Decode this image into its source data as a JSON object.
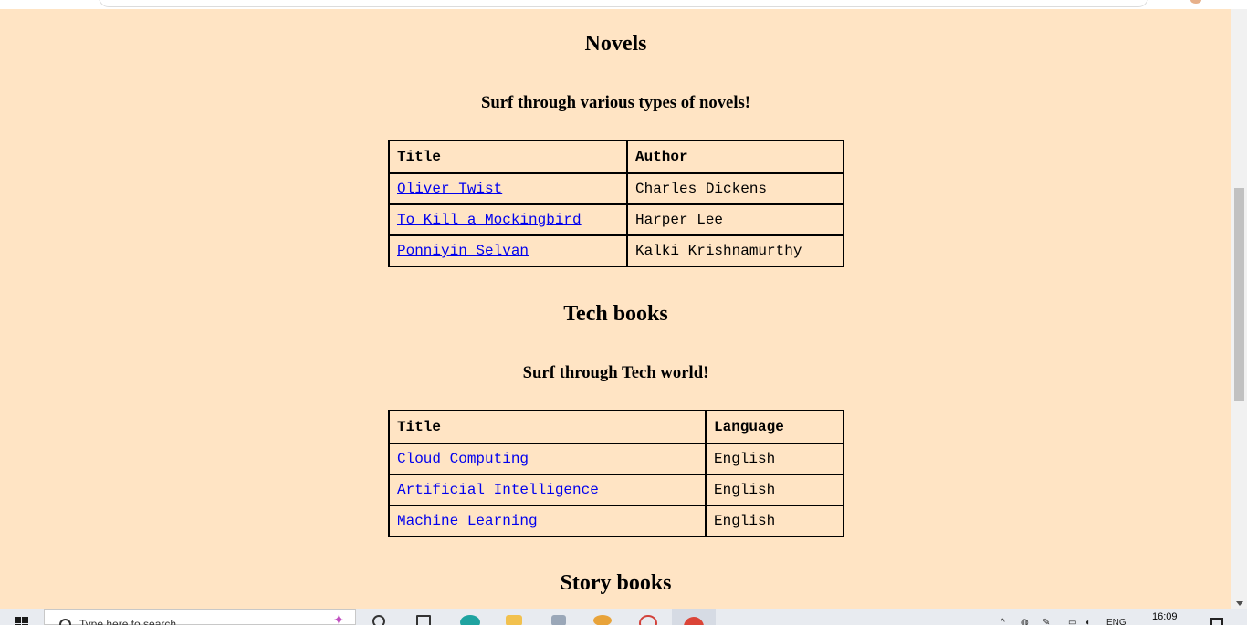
{
  "sections": [
    {
      "title": "Novels",
      "subtitle": "Surf through various types of novels!",
      "columns": [
        "Title",
        "Author"
      ],
      "rows": [
        {
          "title": "Oliver Twist",
          "value": "Charles Dickens"
        },
        {
          "title": "To Kill a Mockingbird",
          "value": "Harper Lee"
        },
        {
          "title": "Ponniyin Selvan",
          "value": "Kalki Krishnamurthy"
        }
      ]
    },
    {
      "title": "Tech books",
      "subtitle": "Surf through Tech world!",
      "columns": [
        "Title",
        "Language"
      ],
      "rows": [
        {
          "title": "Cloud Computing",
          "value": "English"
        },
        {
          "title": "Artificial Intelligence",
          "value": "English"
        },
        {
          "title": "Machine Learning",
          "value": "English"
        }
      ]
    },
    {
      "title": "Story books"
    }
  ],
  "taskbar": {
    "search_placeholder": "Type here to search",
    "clock": "16:09",
    "language": "ENG"
  },
  "colors": {
    "page_background": "#ffe4c4",
    "link": "#0000ee"
  }
}
